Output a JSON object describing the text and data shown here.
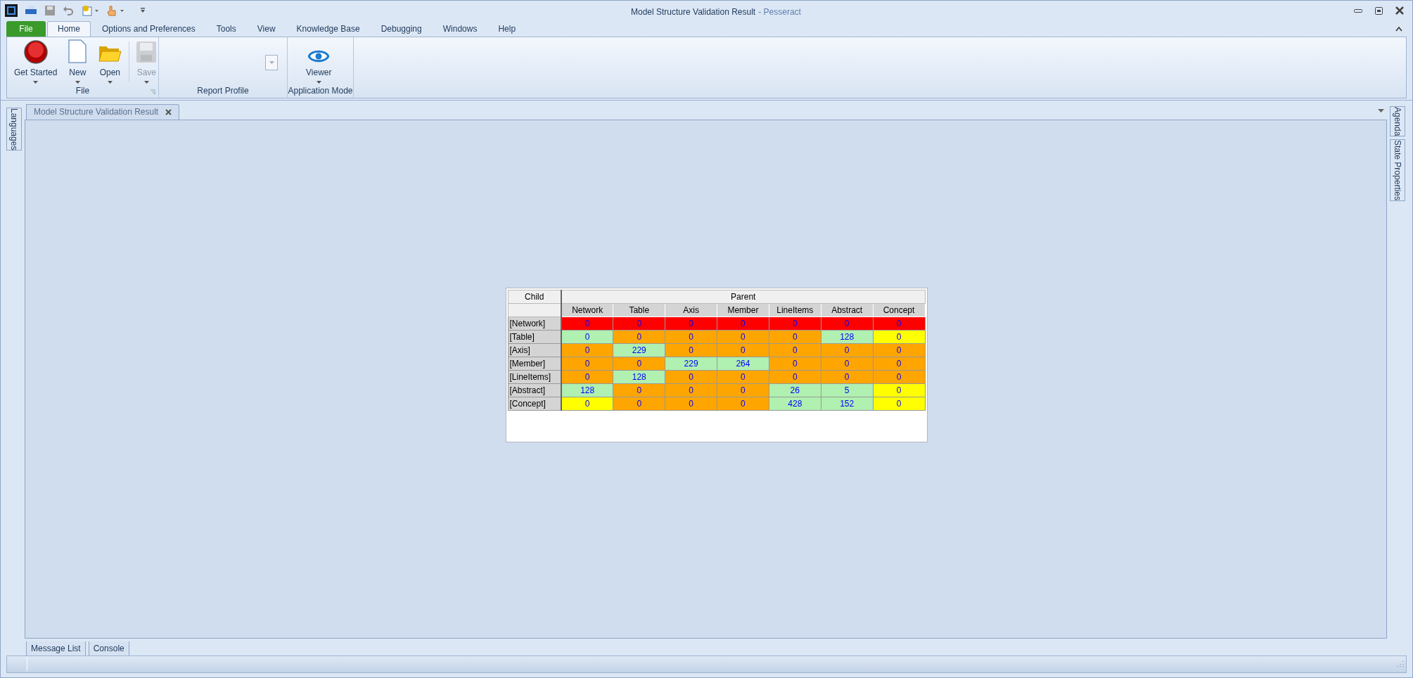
{
  "window": {
    "title": "Model Structure Validation Result",
    "app": "- Pesseract"
  },
  "menu_tabs": [
    {
      "label": "File",
      "kind": "file",
      "selected": false
    },
    {
      "label": "Home",
      "kind": "tab",
      "selected": true
    },
    {
      "label": "Options and Preferences",
      "kind": "tab",
      "selected": false
    },
    {
      "label": "Tools",
      "kind": "tab",
      "selected": false
    },
    {
      "label": "View",
      "kind": "tab",
      "selected": false
    },
    {
      "label": "Knowledge Base",
      "kind": "tab",
      "selected": false
    },
    {
      "label": "Debugging",
      "kind": "tab",
      "selected": false
    },
    {
      "label": "Windows",
      "kind": "tab",
      "selected": false
    },
    {
      "label": "Help",
      "kind": "tab",
      "selected": false
    }
  ],
  "ribbon_groups": [
    {
      "label": "File",
      "launcher": true,
      "buttons": [
        {
          "label": "Get Started",
          "disabled": false
        },
        {
          "label": "New",
          "disabled": false
        },
        {
          "label": "Open",
          "disabled": false
        },
        {
          "label": "Save",
          "disabled": true
        }
      ]
    },
    {
      "label": "Report Profile",
      "launcher": false
    },
    {
      "label": "Application Mode",
      "launcher": false,
      "buttons": [
        {
          "label": "Viewer",
          "disabled": false
        }
      ]
    }
  ],
  "left_panels": [
    "Languages"
  ],
  "right_panels": [
    "Agenda",
    "State Properties"
  ],
  "document_tab": {
    "title": "Model Structure Validation Result"
  },
  "matrix": {
    "corner": "Child",
    "parent_header": "Parent",
    "columns": [
      "Network",
      "Table",
      "Axis",
      "Member",
      "LineItems",
      "Abstract",
      "Concept"
    ],
    "rows": [
      {
        "label": "[Network]",
        "cells": [
          {
            "value": "0",
            "color": "#ff0000"
          },
          {
            "value": "0",
            "color": "#ff0000"
          },
          {
            "value": "0",
            "color": "#ff0000"
          },
          {
            "value": "0",
            "color": "#ff0000"
          },
          {
            "value": "0",
            "color": "#ff0000"
          },
          {
            "value": "0",
            "color": "#ff0000"
          },
          {
            "value": "0",
            "color": "#ff0000"
          }
        ]
      },
      {
        "label": "[Table]",
        "cells": [
          {
            "value": "0",
            "color": "#b0f0b0"
          },
          {
            "value": "0",
            "color": "#ffa500"
          },
          {
            "value": "0",
            "color": "#ffa500"
          },
          {
            "value": "0",
            "color": "#ffa500"
          },
          {
            "value": "0",
            "color": "#ffa500"
          },
          {
            "value": "128",
            "color": "#b0f0b0"
          },
          {
            "value": "0",
            "color": "#ffff00"
          }
        ]
      },
      {
        "label": "[Axis]",
        "cells": [
          {
            "value": "0",
            "color": "#ffa500"
          },
          {
            "value": "229",
            "color": "#b0f0b0"
          },
          {
            "value": "0",
            "color": "#ffa500"
          },
          {
            "value": "0",
            "color": "#ffa500"
          },
          {
            "value": "0",
            "color": "#ffa500"
          },
          {
            "value": "0",
            "color": "#ffa500"
          },
          {
            "value": "0",
            "color": "#ffa500"
          }
        ]
      },
      {
        "label": "[Member]",
        "cells": [
          {
            "value": "0",
            "color": "#ffa500"
          },
          {
            "value": "0",
            "color": "#ffa500"
          },
          {
            "value": "229",
            "color": "#b0f0b0"
          },
          {
            "value": "264",
            "color": "#b0f0b0"
          },
          {
            "value": "0",
            "color": "#ffa500"
          },
          {
            "value": "0",
            "color": "#ffa500"
          },
          {
            "value": "0",
            "color": "#ffa500"
          }
        ]
      },
      {
        "label": "[LineItems]",
        "cells": [
          {
            "value": "0",
            "color": "#ffa500"
          },
          {
            "value": "128",
            "color": "#b0f0b0"
          },
          {
            "value": "0",
            "color": "#ffa500"
          },
          {
            "value": "0",
            "color": "#ffa500"
          },
          {
            "value": "0",
            "color": "#ffa500"
          },
          {
            "value": "0",
            "color": "#ffa500"
          },
          {
            "value": "0",
            "color": "#ffa500"
          }
        ]
      },
      {
        "label": "[Abstract]",
        "cells": [
          {
            "value": "128",
            "color": "#b0f0b0"
          },
          {
            "value": "0",
            "color": "#ffa500"
          },
          {
            "value": "0",
            "color": "#ffa500"
          },
          {
            "value": "0",
            "color": "#ffa500"
          },
          {
            "value": "26",
            "color": "#b0f0b0"
          },
          {
            "value": "5",
            "color": "#b0f0b0"
          },
          {
            "value": "0",
            "color": "#ffff00"
          }
        ]
      },
      {
        "label": "[Concept]",
        "cells": [
          {
            "value": "0",
            "color": "#ffff00"
          },
          {
            "value": "0",
            "color": "#ffa500"
          },
          {
            "value": "0",
            "color": "#ffa500"
          },
          {
            "value": "0",
            "color": "#ffa500"
          },
          {
            "value": "428",
            "color": "#b0f0b0"
          },
          {
            "value": "152",
            "color": "#b0f0b0"
          },
          {
            "value": "0",
            "color": "#ffff00"
          }
        ]
      }
    ]
  },
  "bottom_tabs": [
    "Message List",
    "Console"
  ]
}
